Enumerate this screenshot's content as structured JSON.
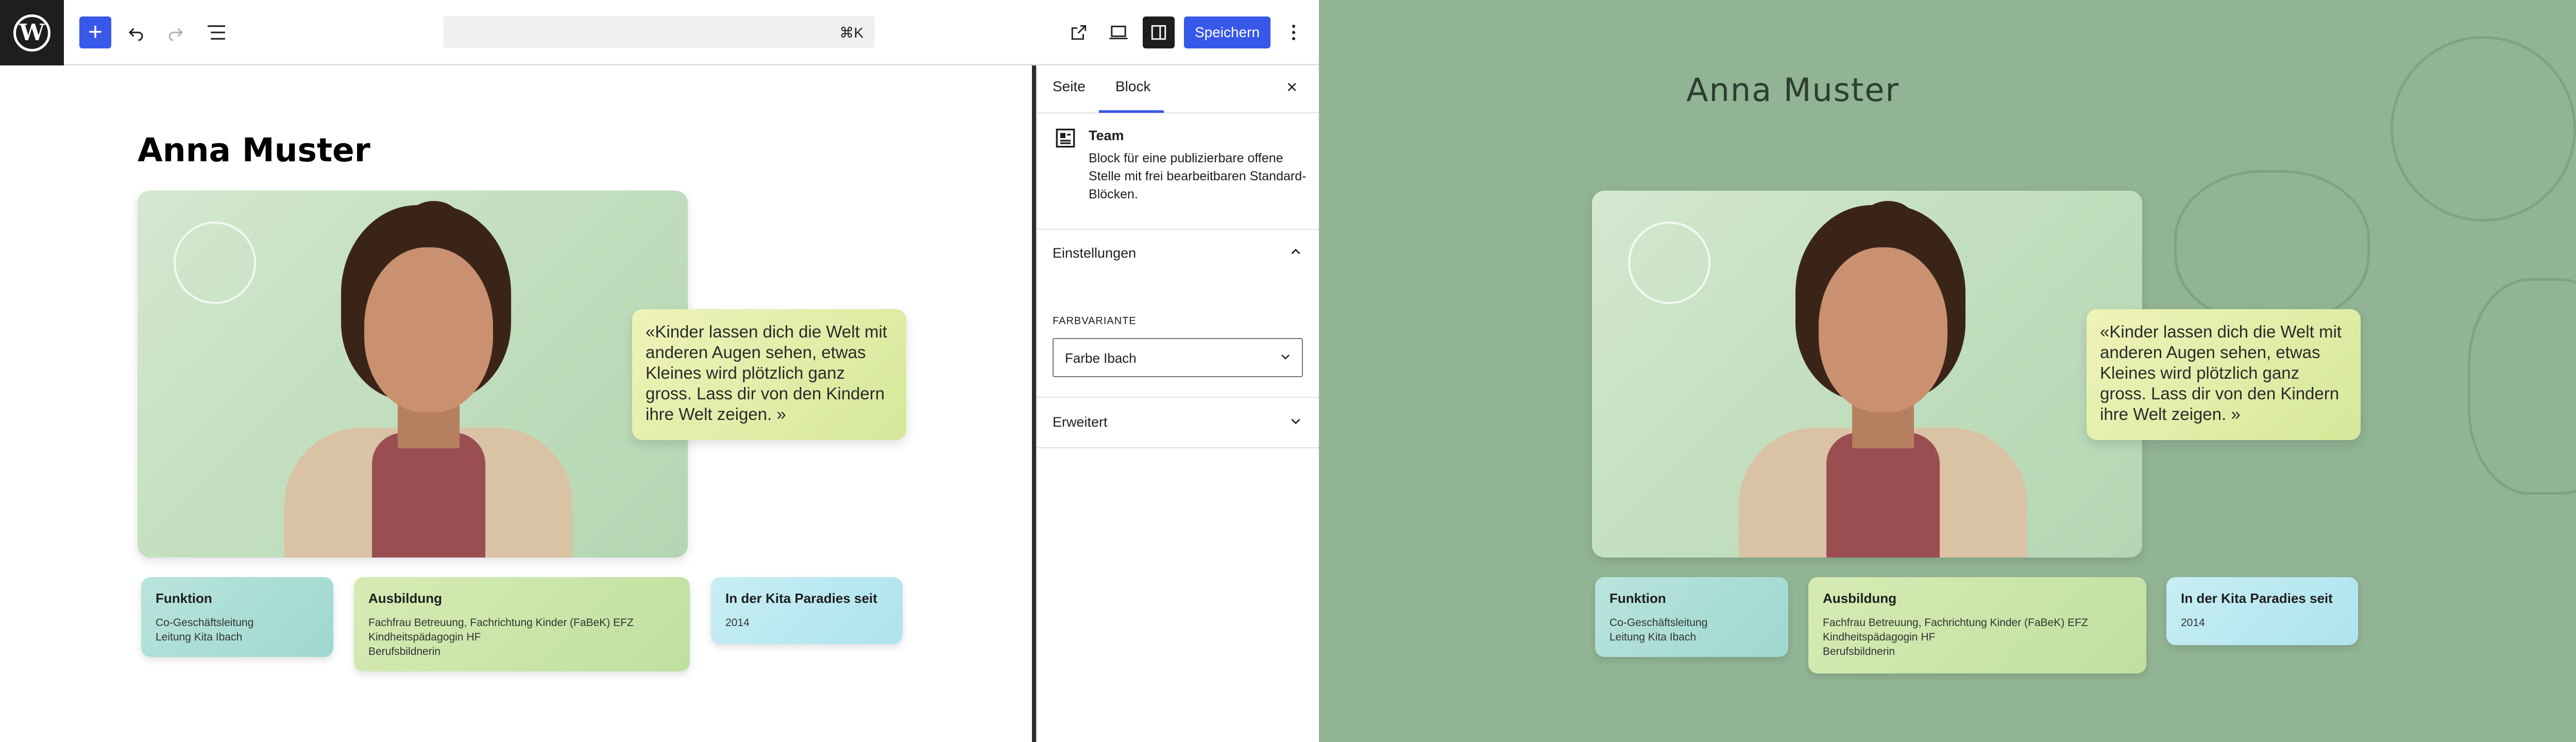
{
  "toolbar": {
    "shortcut": "⌘K",
    "save_label": "Speichern"
  },
  "editor": {
    "name": "Anna Muster"
  },
  "settings": {
    "tabs": [
      "Seite",
      "Block"
    ],
    "active_tab": "Block",
    "block": {
      "title": "Team",
      "description": "Block für eine publizierbare offene Stelle mit frei bearbeitbaren Standard-Blöcken."
    },
    "panel_settings": "Einstellungen",
    "color_variant_label": "FARBVARIANTE",
    "color_variant_value": "Farbe Ibach",
    "panel_advanced": "Erweitert"
  },
  "team": {
    "quote": "«Kinder lassen dich die Welt mit anderen Augen sehen, etwas Kleines wird plötzlich ganz gross. Lass dir von den Kindern ihre Welt zeigen. »",
    "function": {
      "heading": "Funktion",
      "lines": [
        "Co-Geschäftsleitung",
        "Leitung Kita Ibach"
      ]
    },
    "education": {
      "heading": "Ausbildung",
      "lines": [
        "Fachfrau Betreuung, Fachrichtung Kinder (FaBeK) EFZ",
        "Kindheitspädagogin HF",
        "Berufsbildnerin"
      ]
    },
    "since": {
      "heading": "In der Kita Paradies seit",
      "value": "2014"
    }
  },
  "colors": {
    "accent": "#3858e9",
    "preview_bg": "#91b494"
  }
}
